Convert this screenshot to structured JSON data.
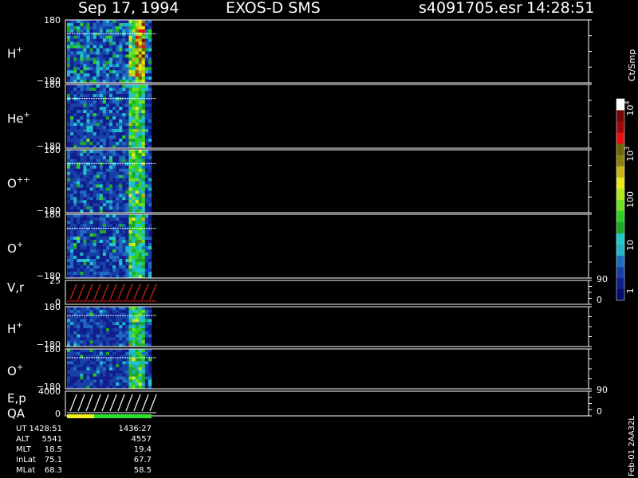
{
  "header": {
    "date": "Sep 17, 1994",
    "instrument": "EXOS-D SMS",
    "file": "s4091705.esr",
    "time": "14:28:51"
  },
  "colorbar": {
    "unit": "Ct/Smp",
    "labels": [
      {
        "text": "1",
        "value": 1
      },
      {
        "text": "10",
        "value": 10
      },
      {
        "text": "100",
        "value": 100
      },
      {
        "text": "10",
        "sup": "3",
        "value": 1000
      },
      {
        "text": "10",
        "sup": "4",
        "value": 10000
      }
    ],
    "colors": [
      "#0a0a6e",
      "#101f8c",
      "#1840a8",
      "#1e6cc0",
      "#1fb4c8",
      "#20c8c8",
      "#1ea82a",
      "#2ed028",
      "#70e020",
      "#b4e81c",
      "#e8e81a",
      "#c8b414",
      "#8c7e10",
      "#6e640a",
      "#e81010",
      "#a00a0a",
      "#780808",
      "#ffffff"
    ]
  },
  "chart_data": {
    "type": "heatmap",
    "panels": [
      {
        "label": "H",
        "sup": "+",
        "ytop": "180",
        "ybot": "−180",
        "kind": "spec"
      },
      {
        "label": "He",
        "sup": "+",
        "ytop": "180",
        "ybot": "−180",
        "kind": "spec"
      },
      {
        "label": "O",
        "sup": "++",
        "ytop": "180",
        "ybot": "−180",
        "kind": "spec"
      },
      {
        "label": "O",
        "sup": "+",
        "ytop": "180",
        "ybot": "−180",
        "kind": "spec"
      },
      {
        "label": "V,r",
        "sup": "",
        "ytop": "25",
        "ybot": "0",
        "rtop": "90",
        "rbot": "0",
        "kind": "line"
      },
      {
        "label": "H",
        "sup": "+",
        "ytop": "180",
        "ybot": "−180",
        "kind": "spec"
      },
      {
        "label": "O",
        "sup": "+",
        "ytop": "180",
        "ybot": "−180",
        "kind": "spec"
      },
      {
        "label": "E,p",
        "label2": "QA",
        "sup": "",
        "ytop": "4000",
        "ybot": "0",
        "rtop": "90",
        "rbot": "0",
        "kind": "line"
      }
    ]
  },
  "footer": {
    "rows": [
      {
        "label": "UT",
        "v1": "1428:51",
        "v2": "1436:27"
      },
      {
        "label": "ALT",
        "v1": "5541",
        "v2": "4557"
      },
      {
        "label": "MLT",
        "v1": "18.5",
        "v2": "19.4"
      },
      {
        "label": "InLat",
        "v1": "75.1",
        "v2": "67.7"
      },
      {
        "label": "MLat",
        "v1": "68.3",
        "v2": "58.5"
      }
    ],
    "stamp": "Feb-01 2AA32L"
  }
}
